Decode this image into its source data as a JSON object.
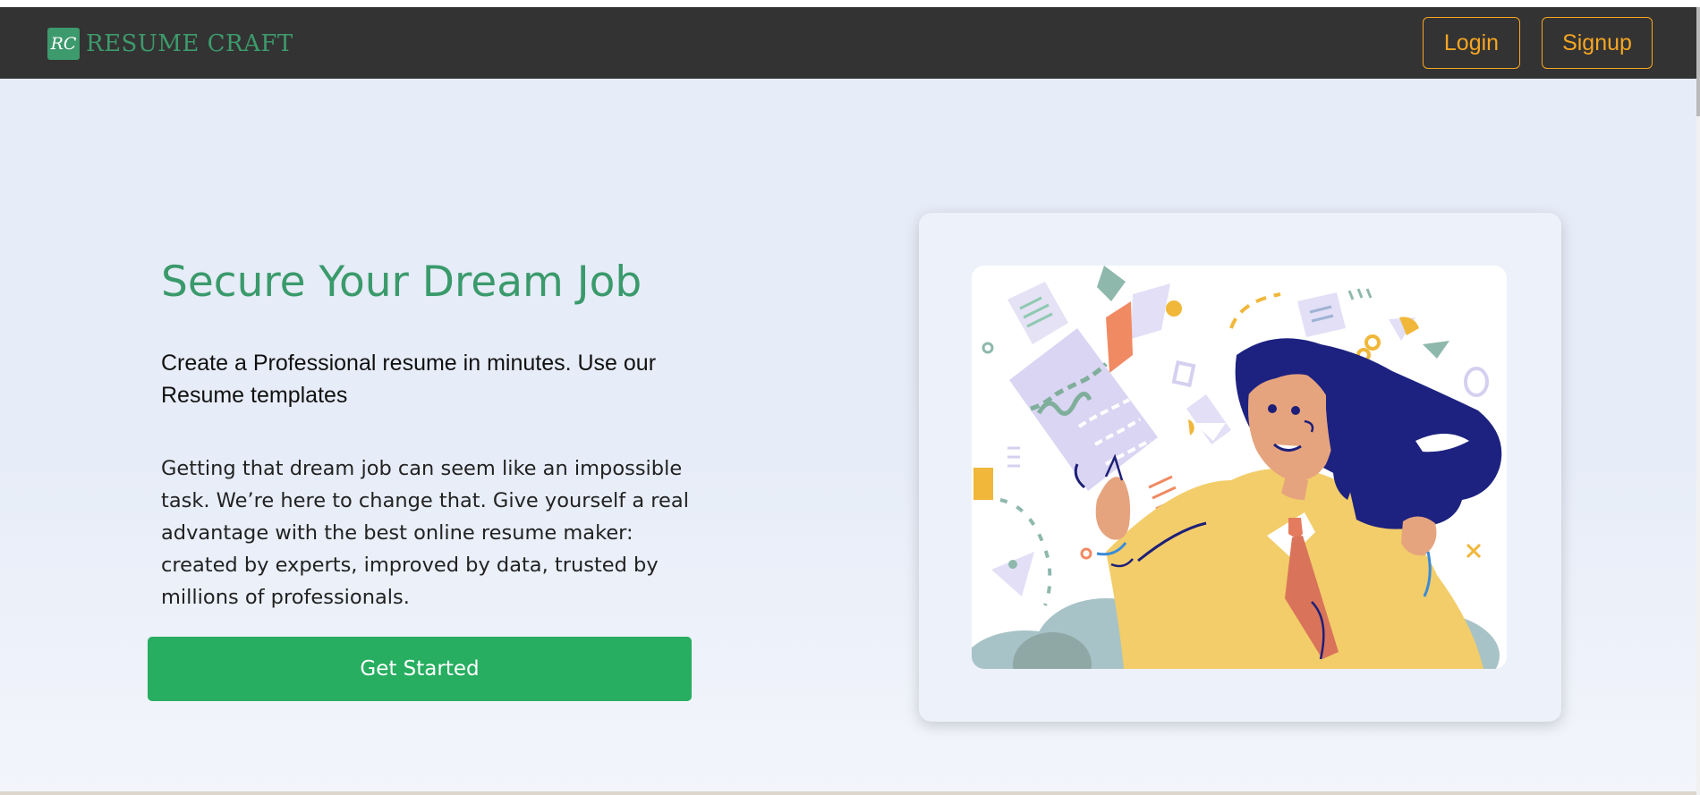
{
  "navbar": {
    "logo_initials": "RC",
    "brand_name": "RESUME CRAFT",
    "login_label": "Login",
    "signup_label": "Signup"
  },
  "hero": {
    "headline": "Secure Your Dream Job",
    "subheadline": "Create a Professional resume in minutes. Use our Resume templates",
    "description": "Getting that dream job can seem like an impossible task. We’re here to change that. Give yourself a real advantage with the best online resume maker: created by experts, improved by data, trusted by millions of professionals.",
    "cta_label": "Get Started"
  },
  "colors": {
    "navbar_bg": "#333333",
    "brand_green": "#3d9a6c",
    "accent_orange": "#f5a623",
    "cta_green": "#27ae60",
    "hero_bg": "#e6ecf8"
  }
}
